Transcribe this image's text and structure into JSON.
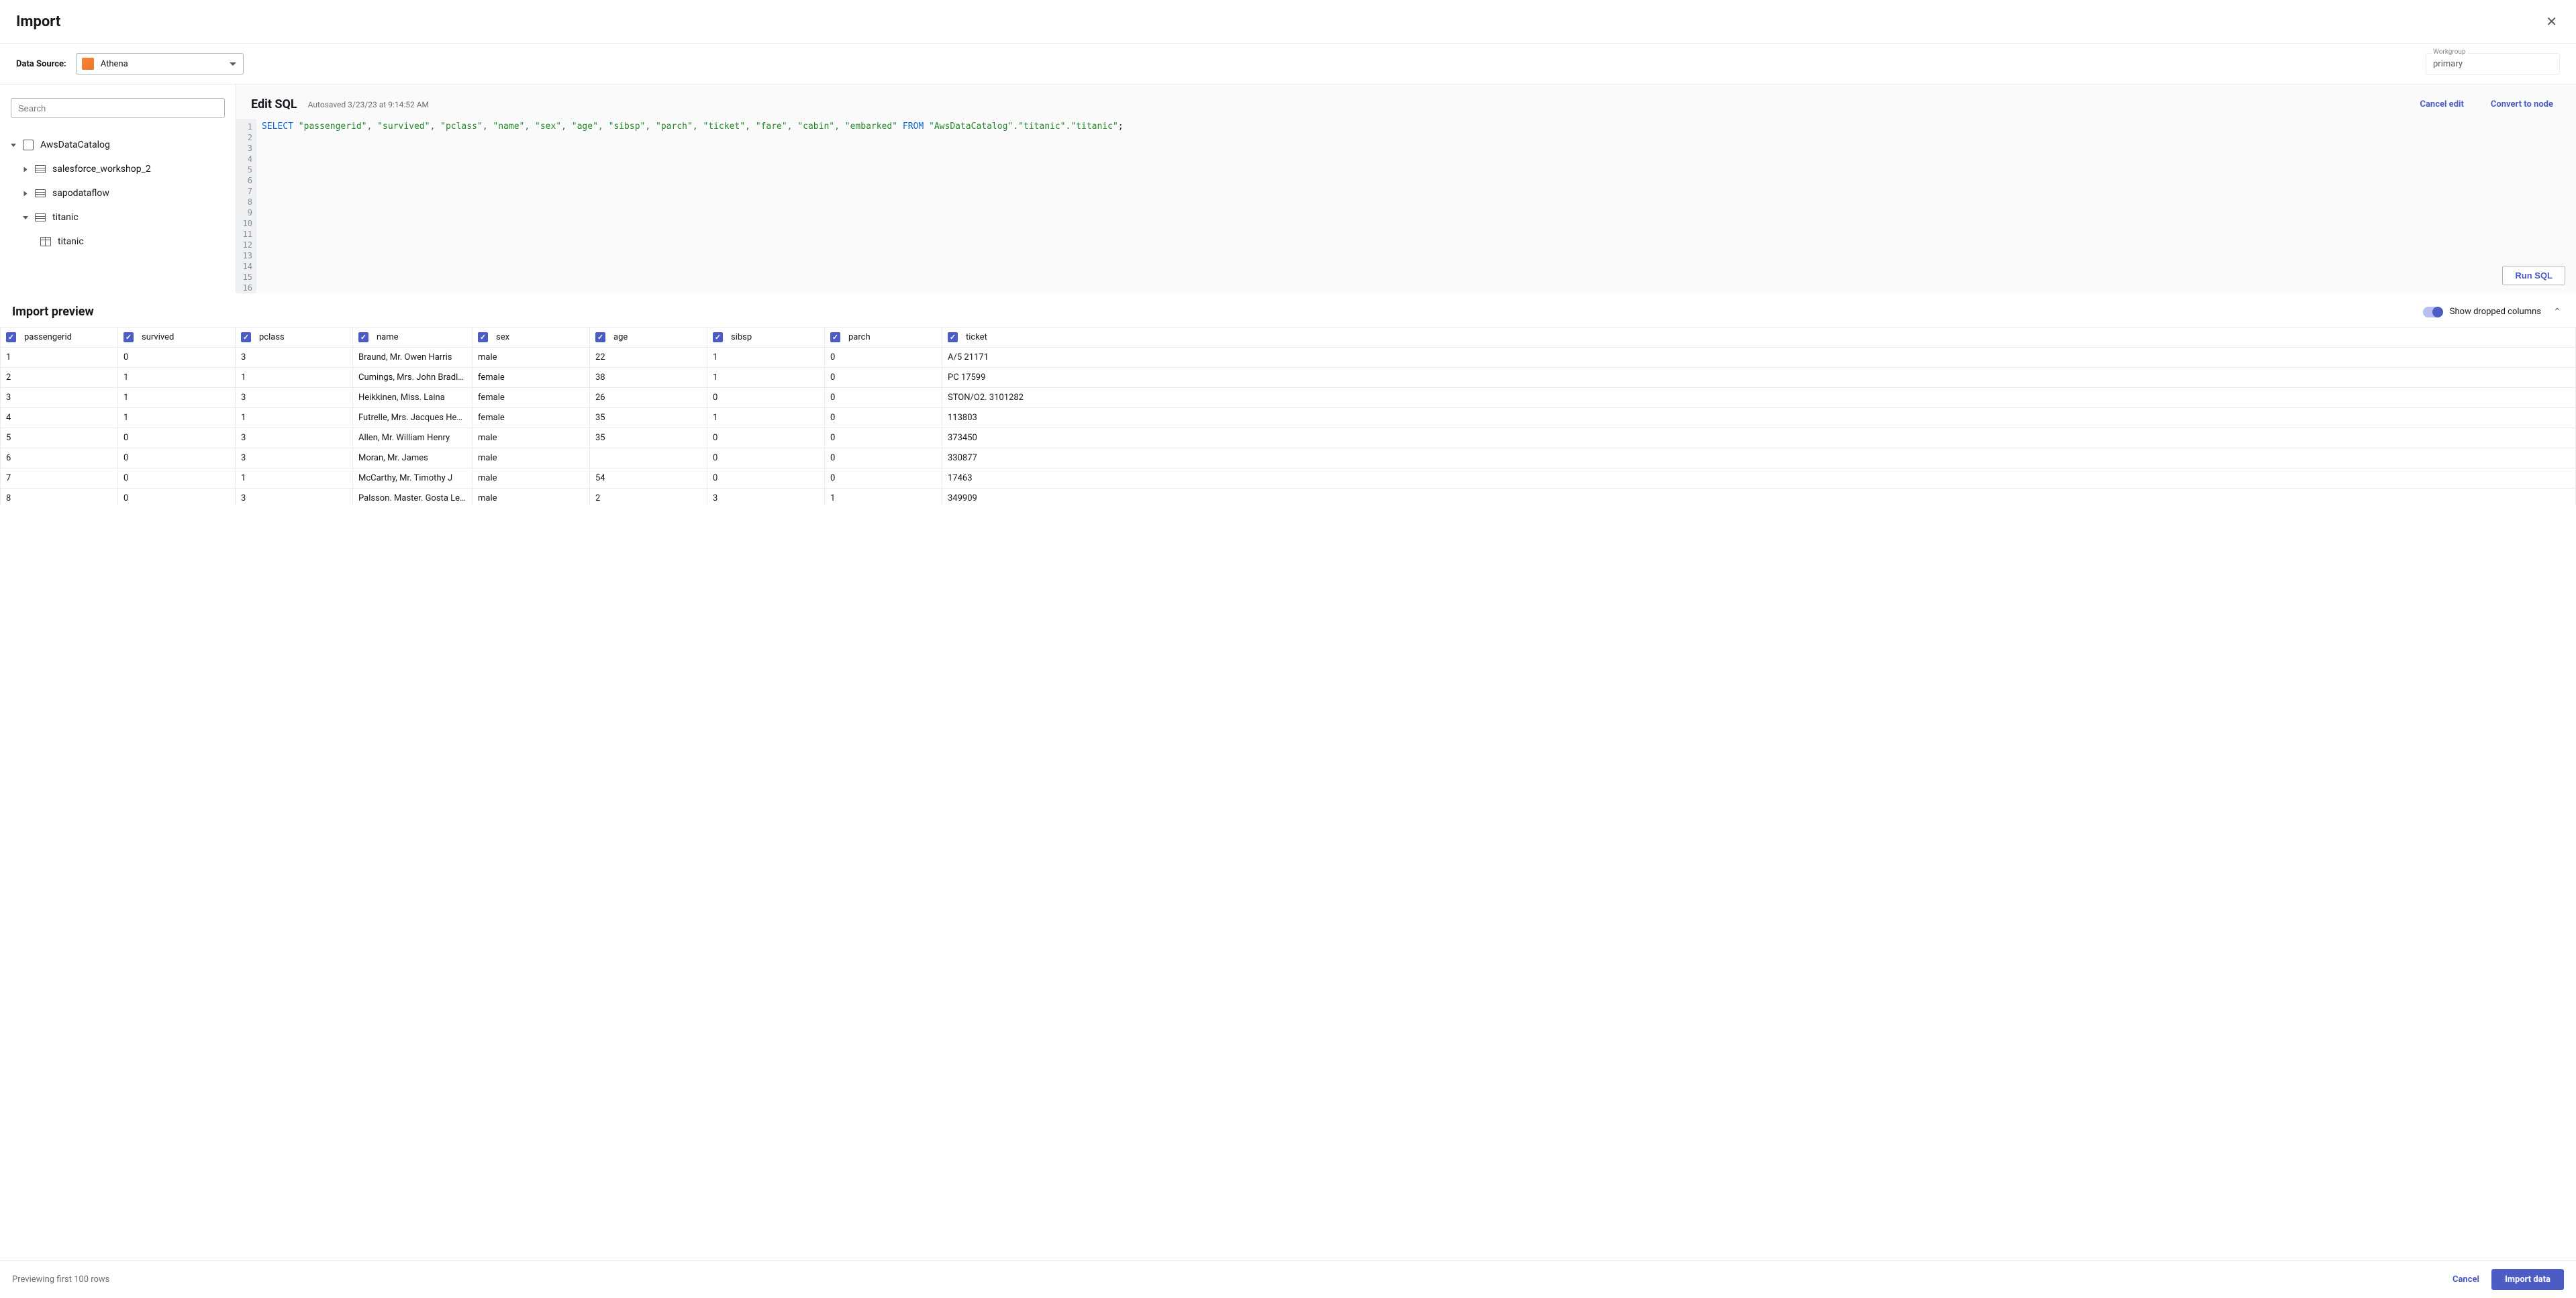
{
  "header": {
    "title": "Import"
  },
  "dataSource": {
    "label": "Data Source:",
    "value": "Athena"
  },
  "workgroup": {
    "label": "Workgroup",
    "value": "primary"
  },
  "sidebar": {
    "searchPlaceholder": "Search",
    "root": "AwsDataCatalog",
    "dbs": [
      {
        "name": "salesforce_workshop_2"
      },
      {
        "name": "sapodataflow"
      },
      {
        "name": "titanic",
        "expanded": true,
        "tables": [
          "titanic"
        ]
      }
    ]
  },
  "editor": {
    "title": "Edit SQL",
    "autosaved": "Autosaved 3/23/23 at 9:14:52 AM",
    "cancelEdit": "Cancel edit",
    "convert": "Convert to node",
    "runSql": "Run SQL",
    "sql": {
      "select": "SELECT",
      "cols": "\"passengerid\", \"survived\", \"pclass\", \"name\", \"sex\", \"age\", \"sibsp\", \"parch\", \"ticket\", \"fare\", \"cabin\", \"embarked\"",
      "from": "FROM",
      "table": "\"AwsDataCatalog\".\"titanic\".\"titanic\"",
      "semi": ";"
    },
    "lines": 16
  },
  "preview": {
    "title": "Import preview",
    "toggleLabel": "Show dropped columns",
    "columns": [
      "passengerid",
      "survived",
      "pclass",
      "name",
      "sex",
      "age",
      "sibsp",
      "parch",
      "ticket"
    ],
    "rows": [
      [
        "1",
        "0",
        "3",
        "Braund, Mr. Owen Harris",
        "male",
        "22",
        "1",
        "0",
        "A/5 21171"
      ],
      [
        "2",
        "1",
        "1",
        "Cumings, Mrs. John Bradley (Florenc",
        "female",
        "38",
        "1",
        "0",
        "PC 17599"
      ],
      [
        "3",
        "1",
        "3",
        "Heikkinen, Miss. Laina",
        "female",
        "26",
        "0",
        "0",
        "STON/O2. 3101282"
      ],
      [
        "4",
        "1",
        "1",
        "Futrelle, Mrs. Jacques Heath (Lily Ma",
        "female",
        "35",
        "1",
        "0",
        "113803"
      ],
      [
        "5",
        "0",
        "3",
        "Allen, Mr. William Henry",
        "male",
        "35",
        "0",
        "0",
        "373450"
      ],
      [
        "6",
        "0",
        "3",
        "Moran, Mr. James",
        "male",
        "",
        "0",
        "0",
        "330877"
      ],
      [
        "7",
        "0",
        "1",
        "McCarthy, Mr. Timothy J",
        "male",
        "54",
        "0",
        "0",
        "17463"
      ],
      [
        "8",
        "0",
        "3",
        "Palsson. Master. Gosta Leonard",
        "male",
        "2",
        "3",
        "1",
        "349909"
      ]
    ]
  },
  "footer": {
    "note": "Previewing first 100 rows",
    "cancel": "Cancel",
    "import": "Import data"
  }
}
